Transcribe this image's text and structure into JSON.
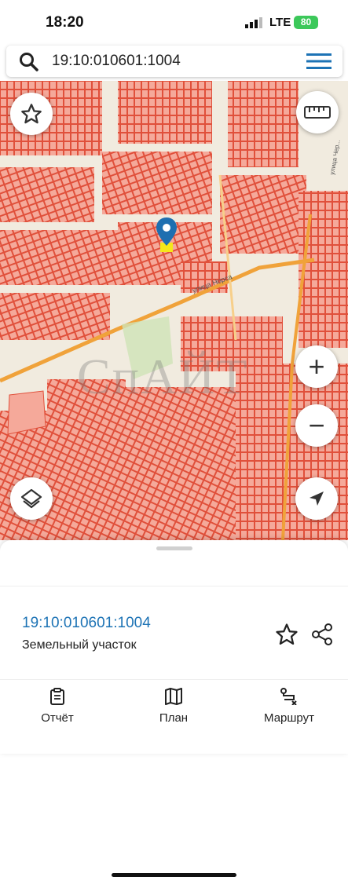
{
  "status_bar": {
    "time": "18:20",
    "network": "LTE",
    "battery": "80"
  },
  "search": {
    "query": "19:10:010601:1004",
    "search_icon": "search-icon",
    "menu_icon": "hamburger-menu-icon"
  },
  "map": {
    "watermark": "СпАЙТ",
    "controls": [
      "star-icon",
      "ruler-icon",
      "layers-icon",
      "zoom-in",
      "zoom-out",
      "location-arrow-icon"
    ],
    "street_labels": [
      "улица Норса",
      "улица Чер..."
    ],
    "zoom_in_label": "+",
    "zoom_out_label": "−",
    "colors": {
      "background": "#f1ebdf",
      "parcel_fill": "#f5a99a",
      "parcel_stroke": "#e0503b",
      "road": "#f0a23a",
      "pin": "#1e6fb0",
      "pin_dot": "#f5e71a"
    }
  },
  "details": {
    "cadastral_number": "19:10:010601:1004",
    "property_type": "Земельный участок",
    "star_icon": "star-outline-icon",
    "share_icon": "share-icon"
  },
  "tabs": [
    {
      "label": "Отчёт",
      "icon": "report-clipboard-icon"
    },
    {
      "label": "План",
      "icon": "map-book-icon"
    },
    {
      "label": "Маршрут",
      "icon": "route-icon"
    }
  ]
}
